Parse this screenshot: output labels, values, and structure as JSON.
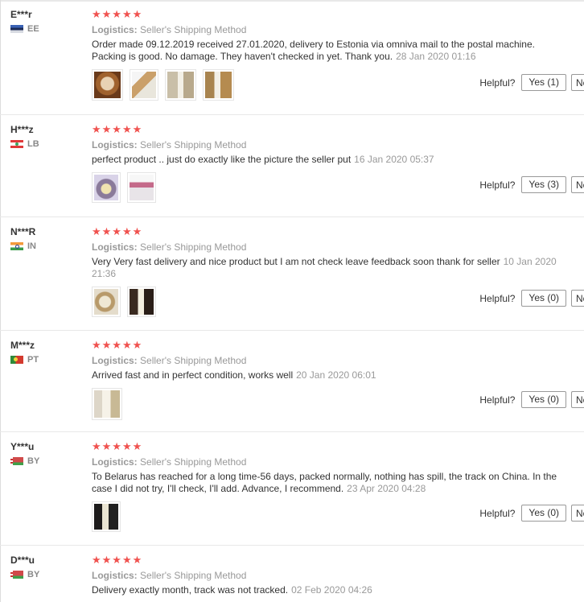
{
  "helpful_label": "Helpful?",
  "no_label": "No",
  "logistics_label": "Logistics:",
  "stars": "★★★★★",
  "reviews": [
    {
      "user": "E***r",
      "country": "EE",
      "shipping": "Seller's Shipping Method",
      "text": "Order made 09.12.2019 received 27.01.2020, delivery to Estonia via omniva mail to the postal machine. Packing is good. No damage. They haven't checked in yet. Thank you.",
      "date": "28 Jan 2020 01:16",
      "yes": "Yes (1)",
      "photos": [
        "photo-1",
        "photo-2",
        "photo-3",
        "photo-4"
      ]
    },
    {
      "user": "H***z",
      "country": "LB",
      "shipping": "Seller's Shipping Method",
      "text": "perfect product .. just do exactly like the picture the seller put",
      "date": "16 Jan 2020 05:37",
      "yes": "Yes (3)",
      "photos": [
        "photo-1",
        "photo-2"
      ]
    },
    {
      "user": "N***R",
      "country": "IN",
      "shipping": "Seller's Shipping Method",
      "text": "Very Very fast delivery and nice product but I am not check leave feedback soon thank for seller",
      "date": "10 Jan 2020 21:36",
      "yes": "Yes (0)",
      "photos": [
        "photo-1",
        "photo-2"
      ]
    },
    {
      "user": "M***z",
      "country": "PT",
      "shipping": "Seller's Shipping Method",
      "text": "Arrived fast and in perfect condition, works well",
      "date": "20 Jan 2020 06:01",
      "yes": "Yes (0)",
      "photos": [
        "photo-1"
      ]
    },
    {
      "user": "Y***u",
      "country": "BY",
      "shipping": "Seller's Shipping Method",
      "text": "To Belarus has reached for a long time-56 days, packed normally, nothing has spill, the track on China. In the case I did not try, I'll check, I'll add. Advance, I recommend.",
      "date": "23 Apr 2020 04:28",
      "yes": "Yes (0)",
      "photos": [
        "photo-1"
      ]
    },
    {
      "user": "D***u",
      "country": "BY",
      "shipping": "Seller's Shipping Method",
      "text": "Delivery exactly month, track was not tracked.",
      "date": "02 Feb 2020 04:26"
    }
  ]
}
